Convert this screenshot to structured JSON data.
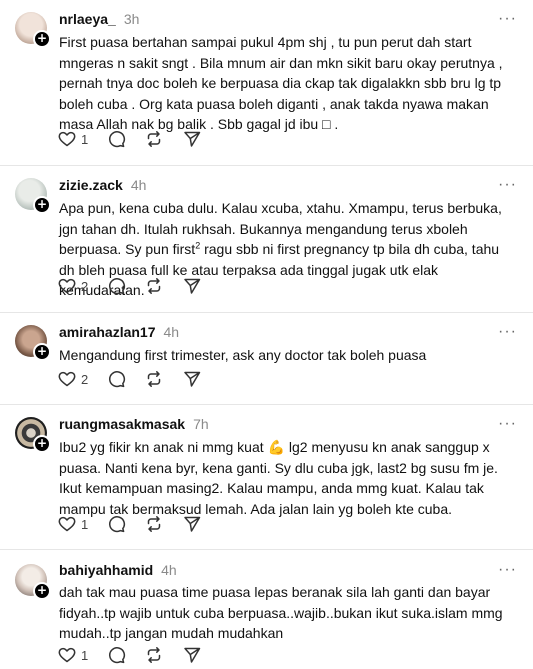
{
  "colors": {
    "text": "#111111",
    "muted": "#8a8a8a",
    "divider": "#e6e6e6",
    "icon": "#333333"
  },
  "icons": {
    "like": "heart-icon",
    "reply": "comment-icon",
    "repost": "repost-icon",
    "share": "send-icon",
    "more": "more-icon",
    "follow": "plus-icon"
  },
  "posts": [
    {
      "username": "nrlaeya_",
      "time": "3h",
      "text": "First puasa bertahan sampai pukul 4pm shj , tu pun perut dah start mngeras n sakit sngt . Bila mnum air dan mkn sikit baru okay perutnya , pernah tnya doc boleh ke berpuasa dia ckap tak digalakkn sbb bru lg tp boleh cuba . Org kata puasa boleh diganti , anak takda nyawa makan masa Allah nak bg balik . Sbb gagal jd ibu □ .",
      "likes": "1"
    },
    {
      "username": "zizie.zack",
      "time": "4h",
      "text_before": "Apa pun, kena cuba dulu. Kalau xcuba, xtahu. Xmampu, terus berbuka, jgn tahan dh. Itulah rukhsah. Bukannya mengandung terus xboleh berpuasa. Sy pun first",
      "text_sup": "2",
      "text_after": " ragu sbb ni first pregnancy tp bila dh cuba, tahu dh bleh puasa full ke atau terpaksa ada tinggal jugak utk elak kemudaratan.",
      "likes": "2"
    },
    {
      "username": "amirahazlan17",
      "time": "4h",
      "text": "Mengandung first trimester, ask any doctor tak boleh puasa",
      "likes": "2"
    },
    {
      "username": "ruangmasakmasak",
      "time": "7h",
      "text_before": "Ibu2 yg fikir kn anak ni mmg kuat ",
      "emoji": "💪",
      "text_after": " lg2 menyusu kn anak sanggup x puasa. Nanti kena byr, kena ganti. Sy dlu cuba jgk, last2 bg susu fm je. Ikut kemampuan masing2. Kalau mampu, anda mmg kuat. Kalau tak mampu tak bermaksud lemah. Ada jalan lain yg boleh kte cuba.",
      "likes": "1"
    },
    {
      "username": "bahiyahhamid",
      "time": "4h",
      "text": "dah tak mau puasa time puasa lepas beranak sila lah ganti dan bayar fidyah..tp wajib untuk cuba berpuasa..wajib..bukan ikut suka.islam mmg mudah..tp jangan mudah mudahkan",
      "likes": "1"
    }
  ]
}
